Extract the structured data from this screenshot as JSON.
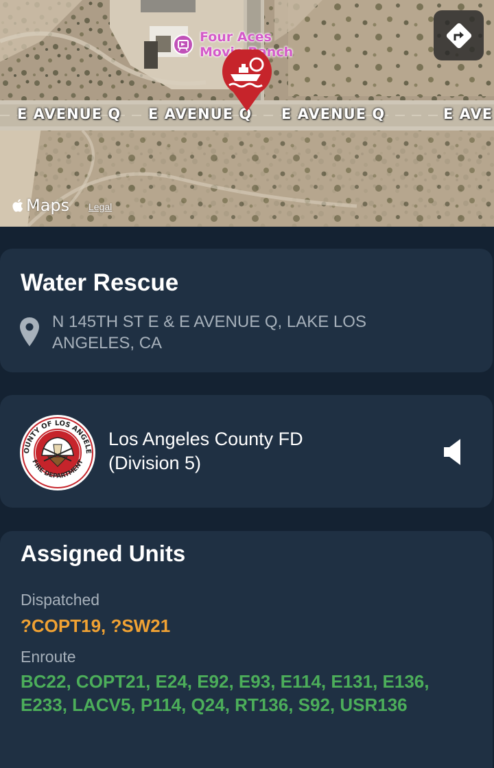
{
  "map": {
    "poi": {
      "name_line1": "Four Aces",
      "name_line2": "Movie Ranch"
    },
    "road_labels": [
      "E AVENUE Q",
      "E AVENUE Q",
      "E AVENUE Q",
      "E AVE"
    ],
    "brand": "Maps",
    "legal": "Legal",
    "pin_icon": "boat-icon",
    "directions_icon": "directions-arrow-icon"
  },
  "incident": {
    "title": "Water Rescue",
    "address": "N 145TH ST E & E AVENUE Q, LAKE LOS ANGELES, CA"
  },
  "agency": {
    "name_line1": "Los Angeles County FD",
    "name_line2": "(Division 5)",
    "logo_text_top": "COUNTY OF LOS ANGELES",
    "logo_text_bottom": "FIRE DEPARTMENT"
  },
  "units": {
    "title": "Assigned Units",
    "dispatched_label": "Dispatched",
    "dispatched": "?COPT19, ?SW21",
    "enroute_label": "Enroute",
    "enroute": "BC22, COPT21, E24, E92, E93, E114, E131, E136, E233, LACV5, P114, Q24, RT136, S92, USR136"
  },
  "colors": {
    "background": "#142232",
    "card": "#1f3043",
    "dispatched": "#f1a233",
    "enroute": "#4cae5a",
    "pin": "#c6242b"
  }
}
